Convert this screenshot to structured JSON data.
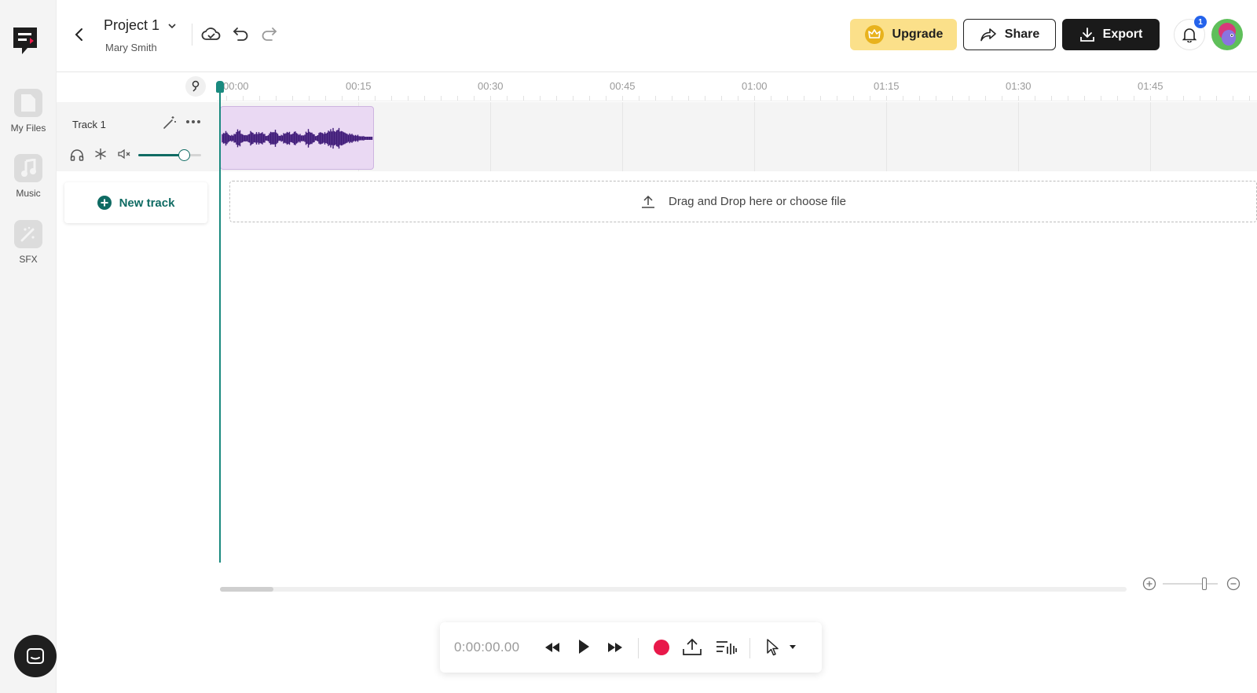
{
  "sidebar": {
    "items": [
      {
        "label": "My Files",
        "icon": "file-icon"
      },
      {
        "label": "Music",
        "icon": "music-note-icon"
      },
      {
        "label": "SFX",
        "icon": "magic-wand-icon"
      }
    ]
  },
  "header": {
    "project_title": "Project 1",
    "owner": "Mary Smith",
    "upgrade_label": "Upgrade",
    "share_label": "Share",
    "export_label": "Export",
    "notification_count": "1"
  },
  "timeline": {
    "ticks": [
      "00:00",
      "00:15",
      "00:30",
      "00:45",
      "01:00",
      "01:15",
      "01:30",
      "01:45"
    ]
  },
  "tracks": [
    {
      "name": "Track 1",
      "volume": 0.72
    }
  ],
  "new_track_label": "New track",
  "drop_zone_label": "Drag and Drop here or choose file",
  "transport": {
    "time": "0:00:00.00"
  },
  "colors": {
    "accent": "#1a8a7f",
    "upgrade_bg": "#fbe08a",
    "export_bg": "#1a1a1a",
    "clip_bg": "#ead9f3",
    "waveform": "#3f1a78",
    "record": "#e8194a",
    "badge": "#2563eb"
  }
}
